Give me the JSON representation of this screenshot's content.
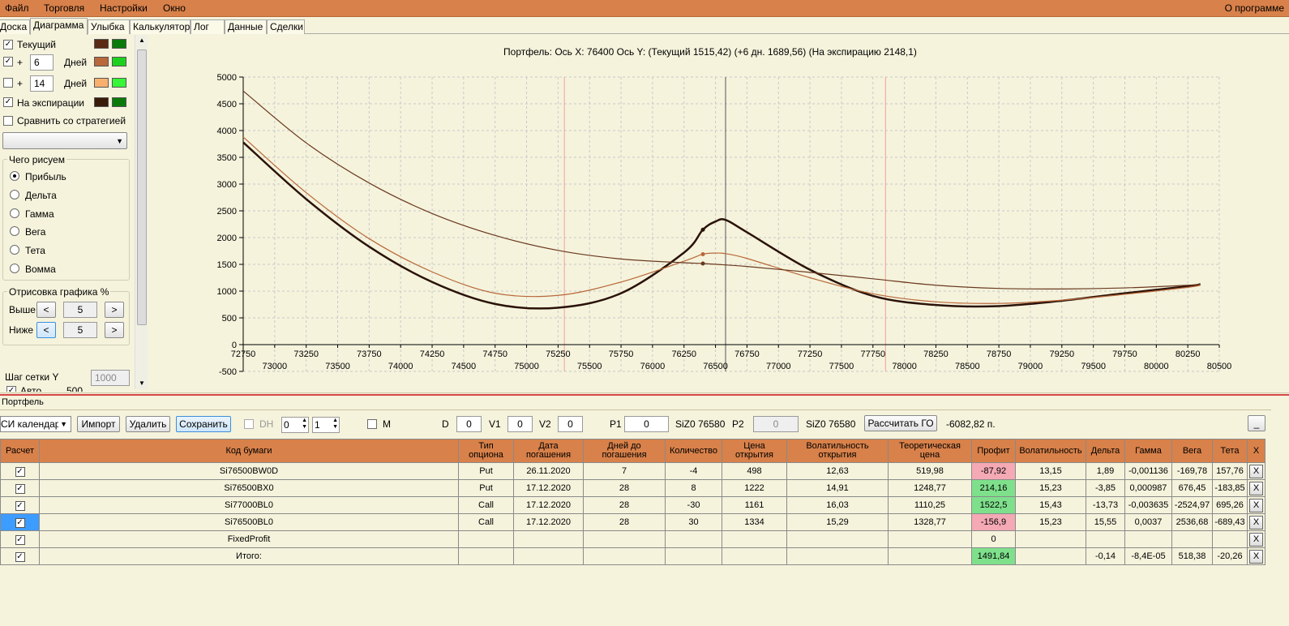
{
  "menu": {
    "file": "Файл",
    "trading": "Торговля",
    "settings": "Настройки",
    "window": "Окно",
    "about": "О программе"
  },
  "tabs": [
    "Доска",
    "Диаграмма",
    "Улыбка",
    "Калькулятор",
    "Лог",
    "Данные",
    "Сделки"
  ],
  "left": {
    "current_label": "Текущий",
    "plus": "+",
    "days_label": "Дней",
    "plus1_value": "6",
    "plus2_value": "14",
    "expiry_label": "На экспирации",
    "compare_label": "Сравнить со стратегией",
    "what_group": "Чего рисуем",
    "radios": [
      "Прибыль",
      "Дельта",
      "Гамма",
      "Вега",
      "Тета",
      "Вомма"
    ],
    "draw_group": "Отрисовка графика %",
    "above_label": "Выше",
    "below_label": "Ниже",
    "above_value": "5",
    "below_value": "5",
    "btn_left": "<",
    "btn_right": ">",
    "grid_step_label": "Шаг сетки Y",
    "grid_step_value": "1000",
    "auto_label": "Авто",
    "auto_value": "500",
    "colors": {
      "current_a": "#5a2a14",
      "current_b": "#0a7a0a",
      "plus1_a": "#b8683a",
      "plus1_b": "#1fd11f",
      "plus2_a": "#f9b06f",
      "plus2_b": "#38f538",
      "expiry_a": "#3a1a08",
      "expiry_b": "#0a7a0a"
    }
  },
  "chart_data": {
    "type": "line",
    "title": "Портфель: Ось X: 76400 Ось Y:  (Текущий 1515,42)  (+6 дн. 1689,56)  (На экспирацию 2148,1)",
    "xlim": [
      72750,
      80500
    ],
    "ylim": [
      -500,
      5000
    ],
    "xticks_top": [
      "72750",
      "73250",
      "73750",
      "74250",
      "74750",
      "75250",
      "75750",
      "76250",
      "76750",
      "77250",
      "77750",
      "78250",
      "78750",
      "79250",
      "79750",
      "80250"
    ],
    "xticks_bottom": [
      "73000",
      "73500",
      "74000",
      "74500",
      "75000",
      "75500",
      "76000",
      "76500",
      "77000",
      "77500",
      "78000",
      "78500",
      "79000",
      "79500",
      "80000",
      "80500"
    ],
    "yticks": [
      "5000",
      "4500",
      "4000",
      "3500",
      "3000",
      "2500",
      "2000",
      "1500",
      "1000",
      "500",
      "0",
      "-500"
    ],
    "cursor_x": 76400,
    "vline_x": 76580,
    "sd_lines": [
      75300,
      77850
    ],
    "series": [
      {
        "color": "#2a1208",
        "x": [
          72750,
          73250,
          73750,
          74250,
          74750,
          75250,
          75750,
          76250,
          76400,
          76500,
          76580,
          76750,
          77250,
          77750,
          78250,
          78750,
          79250,
          79750,
          80250,
          80350
        ],
        "y": [
          3780,
          2720,
          1830,
          1170,
          760,
          690,
          960,
          1720,
          2148,
          2300,
          2330,
          2100,
          1400,
          910,
          740,
          720,
          820,
          960,
          1090,
          1130
        ]
      },
      {
        "color": "#b8683a",
        "x": [
          72750,
          73250,
          73750,
          74250,
          74750,
          75250,
          75750,
          76250,
          76400,
          76500,
          76580,
          76750,
          77250,
          77750,
          78250,
          78750,
          79250,
          79750,
          80250,
          80350
        ],
        "y": [
          3880,
          2840,
          1980,
          1360,
          960,
          920,
          1170,
          1560,
          1690,
          1710,
          1700,
          1610,
          1250,
          950,
          800,
          770,
          830,
          940,
          1070,
          1110
        ]
      },
      {
        "color": "#6b3820",
        "x": [
          72750,
          73250,
          73750,
          74250,
          74750,
          75250,
          75750,
          76250,
          76400,
          76750,
          77250,
          77750,
          78250,
          78750,
          79250,
          79750,
          80250,
          80350
        ],
        "y": [
          4740,
          3770,
          3020,
          2450,
          2040,
          1760,
          1600,
          1530,
          1515,
          1460,
          1350,
          1230,
          1110,
          1050,
          1040,
          1060,
          1110,
          1130
        ]
      }
    ],
    "markers": [
      {
        "x": 76400,
        "y": 2148,
        "color": "#2a1208"
      },
      {
        "x": 76400,
        "y": 1690,
        "color": "#b8683a"
      },
      {
        "x": 76400,
        "y": 1515,
        "color": "#6b3820"
      }
    ]
  },
  "portfolio": {
    "label": "Портфель",
    "strategy_select": "СИ календарь",
    "import": "Импорт",
    "delete": "Удалить",
    "save": "Сохранить",
    "dh": "DH",
    "stepper1": "0",
    "stepper2": "1",
    "m_label": "M",
    "d_label": "D",
    "d_value": "0",
    "v1_label": "V1",
    "v1_value": "0",
    "v2_label": "V2",
    "v2_value": "0",
    "p1_label": "P1",
    "p1_value": "0",
    "p1_instr": "SiZ0 76580",
    "p2_label": "P2",
    "p2_value": "0",
    "p2_instr": "SiZ0 76580",
    "calc_go": "Рассчитать ГО",
    "go_value": "-6082,82 п.",
    "minimize": "_"
  },
  "table": {
    "headers": [
      "Расчет",
      "Код бумаги",
      "Тип опциона",
      "Дата погашения",
      "Дней до погашения",
      "Количество",
      "Цена открытия",
      "Волатильность открытия",
      "Теоретическая цена",
      "Профит",
      "Волатильность",
      "Дельта",
      "Гамма",
      "Вега",
      "Тета",
      "X"
    ],
    "rows": [
      {
        "code": "Si76500BW0D",
        "type": "Put",
        "date": "26.11.2020",
        "days": "7",
        "qty": "-4",
        "price": "498",
        "vol_open": "12,63",
        "theo": "519,98",
        "profit": "-87,92",
        "profit_state": "red",
        "vol": "13,15",
        "delta": "1,89",
        "gamma": "-0,001136",
        "vega": "-169,78",
        "theta": "157,76"
      },
      {
        "code": "Si76500BX0",
        "type": "Put",
        "date": "17.12.2020",
        "days": "28",
        "qty": "8",
        "price": "1222",
        "vol_open": "14,91",
        "theo": "1248,77",
        "profit": "214,16",
        "profit_state": "green",
        "vol": "15,23",
        "delta": "-3,85",
        "gamma": "0,000987",
        "vega": "676,45",
        "theta": "-183,85"
      },
      {
        "code": "Si77000BL0",
        "type": "Call",
        "date": "17.12.2020",
        "days": "28",
        "qty": "-30",
        "price": "1161",
        "vol_open": "16,03",
        "theo": "1110,25",
        "profit": "1522,5",
        "profit_state": "green",
        "vol": "15,43",
        "delta": "-13,73",
        "gamma": "-0,003635",
        "vega": "-2524,97",
        "theta": "695,26"
      },
      {
        "code": "Si76500BL0",
        "type": "Call",
        "date": "17.12.2020",
        "days": "28",
        "qty": "30",
        "price": "1334",
        "vol_open": "15,29",
        "theo": "1328,77",
        "profit": "-156,9",
        "profit_state": "red",
        "vol": "15,23",
        "delta": "15,55",
        "gamma": "0,0037",
        "vega": "2536,68",
        "theta": "-689,43"
      },
      {
        "code": "FixedProfit",
        "type": "",
        "date": "",
        "days": "",
        "qty": "",
        "price": "",
        "vol_open": "",
        "theo": "",
        "profit": "0",
        "profit_state": "none",
        "vol": "",
        "delta": "",
        "gamma": "",
        "vega": "",
        "theta": ""
      },
      {
        "code": "Итого:",
        "type": "",
        "date": "",
        "days": "",
        "qty": "",
        "price": "",
        "vol_open": "",
        "theo": "",
        "profit": "1491,84",
        "profit_state": "green",
        "vol": "",
        "delta": "-0,14",
        "gamma": "-8,4E-05",
        "vega": "518,38",
        "theta": "-20,26"
      }
    ],
    "checkmark": "✓",
    "x_label": "X"
  }
}
